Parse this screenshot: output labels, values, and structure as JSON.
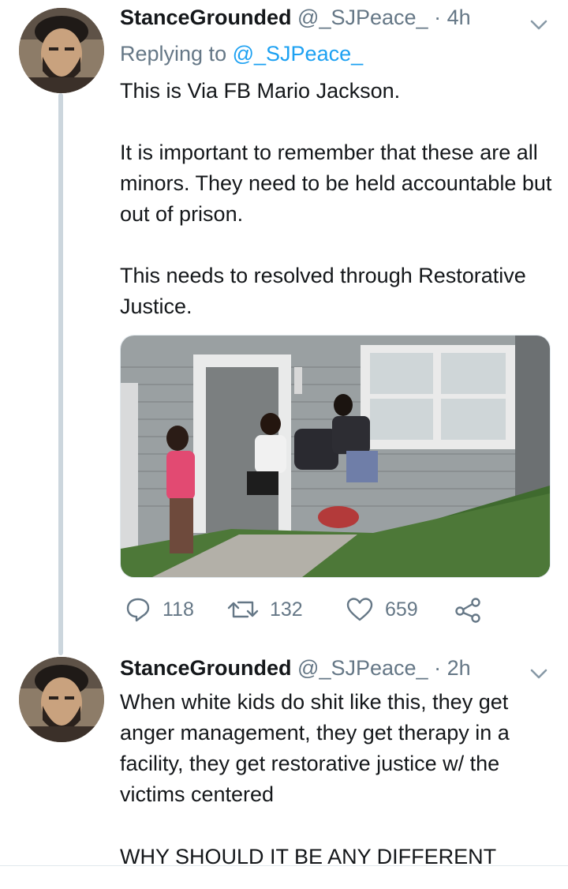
{
  "tweets": [
    {
      "name": "StanceGrounded",
      "handle": "@_SJPeace_",
      "separator": "·",
      "time": "4h",
      "replying_prefix": "Replying to",
      "replying_to": "@_SJPeace_",
      "paragraphs": [
        "This is Via FB Mario Jackson.",
        "It is important to remember that these are all minors. They need to be held accountable but out of prison.",
        "This needs to resolved through Restorative Justice."
      ],
      "replies": "118",
      "retweets": "132",
      "likes": "659"
    },
    {
      "name": "StanceGrounded",
      "handle": "@_SJPeace_",
      "separator": "·",
      "time": "2h",
      "paragraphs": [
        "When white kids do shit like this, they get anger management, they get therapy in a facility, they get restorative justice w/ the victims centered",
        "WHY SHOULD IT BE ANY DIFFERENT"
      ]
    }
  ],
  "icons": {
    "reply": "reply-icon",
    "retweet": "retweet-icon",
    "like": "heart-icon",
    "share": "share-icon",
    "more": "chevron-down-icon"
  },
  "colors": {
    "text": "#14171a",
    "secondary": "#657786",
    "link": "#1da1f2",
    "thread_line": "#ccd6dd"
  }
}
